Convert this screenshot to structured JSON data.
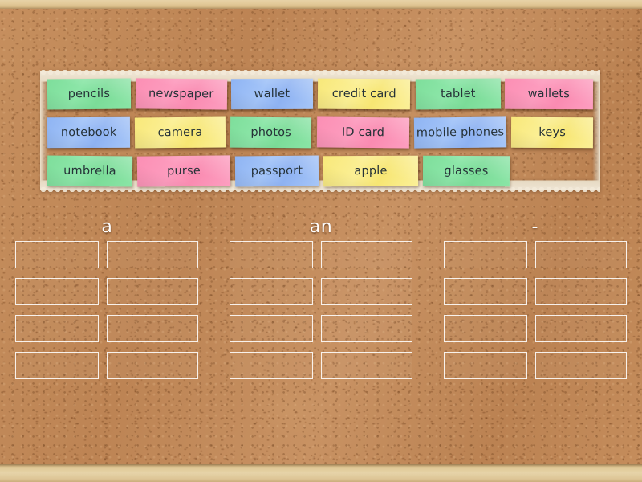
{
  "board": {
    "background": "cork-board",
    "cork_color": "#c18a58",
    "frame_color": "#e3ca9a"
  },
  "tile_tray": {
    "name": "word-tiles-tray",
    "rows": [
      [
        {
          "label": "pencils",
          "color": "green"
        },
        {
          "label": "newspaper",
          "color": "pink"
        },
        {
          "label": "wallet",
          "color": "blue"
        },
        {
          "label": "credit card",
          "color": "yellow"
        },
        {
          "label": "tablet",
          "color": "green"
        },
        {
          "label": "wallets",
          "color": "pink"
        }
      ],
      [
        {
          "label": "notebook",
          "color": "blue"
        },
        {
          "label": "camera",
          "color": "yellow"
        },
        {
          "label": "photos",
          "color": "green"
        },
        {
          "label": "ID card",
          "color": "pink"
        },
        {
          "label": "mobile phones",
          "color": "blue"
        },
        {
          "label": "keys",
          "color": "yellow"
        }
      ],
      [
        {
          "label": "umbrella",
          "color": "green"
        },
        {
          "label": "purse",
          "color": "pink"
        },
        {
          "label": "passport",
          "color": "blue"
        },
        {
          "label": "apple",
          "color": "yellow"
        },
        {
          "label": "glasses",
          "color": "green"
        }
      ]
    ]
  },
  "groups": [
    {
      "label": "a",
      "slot_count": 8
    },
    {
      "label": "an",
      "slot_count": 8
    },
    {
      "label": "-",
      "slot_count": 8
    }
  ],
  "colors": {
    "green": "#8ce6a8",
    "pink": "#fd9cbe",
    "blue": "#a3c4f8",
    "yellow": "#fbef94",
    "slot_border": "#ffffff",
    "label_text": "#ffffff",
    "tile_text": "#263238"
  }
}
